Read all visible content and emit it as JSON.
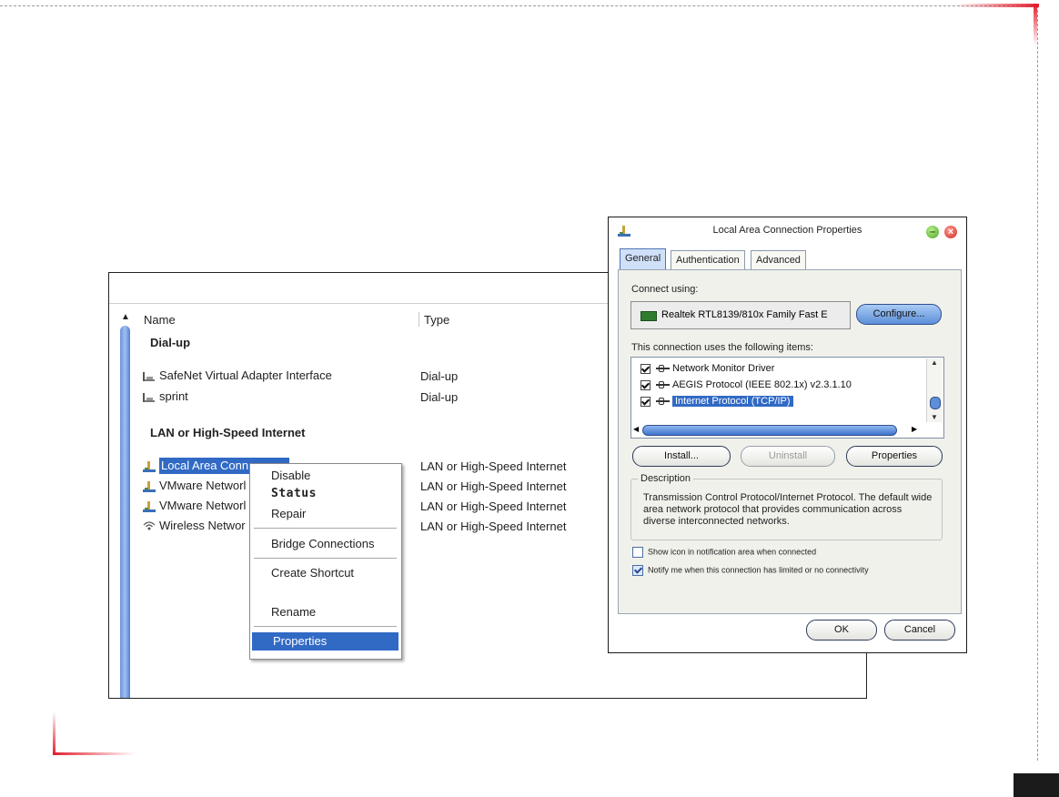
{
  "explorer": {
    "columns": {
      "name": "Name",
      "type": "Type"
    },
    "groups": {
      "dialup": "Dial-up",
      "lan": "LAN or High-Speed Internet"
    },
    "rows": [
      {
        "name": "SafeNet Virtual Adapter Interface",
        "type": "Dial-up",
        "icon": "dialup-connection-icon"
      },
      {
        "name": "sprint",
        "type": "Dial-up",
        "icon": "dialup-connection-icon"
      },
      {
        "name": "Local Area Conn",
        "type": "LAN or High-Speed Internet",
        "icon": "lan-connection-icon"
      },
      {
        "name": "VMware Networl",
        "type": "LAN or High-Speed Internet",
        "icon": "lan-connection-icon"
      },
      {
        "name": "VMware Networl",
        "type": "LAN or High-Speed Internet",
        "icon": "lan-connection-icon"
      },
      {
        "name": "Wireless Networ",
        "type": "LAN or High-Speed Internet",
        "icon": "wireless-connection-icon"
      }
    ]
  },
  "context_menu": {
    "items": [
      "Disable",
      "Status",
      "Repair",
      "Bridge Connections",
      "Create Shortcut",
      "Rename",
      "Properties"
    ],
    "highlighted": "Properties"
  },
  "dialog": {
    "title": "Local Area Connection Properties",
    "tabs": [
      "General",
      "Authentication",
      "Advanced"
    ],
    "active_tab": "General",
    "connect_using_label": "Connect using:",
    "adapter": "Realtek RTL8139/810x Family Fast E",
    "configure_button": "Configure...",
    "items_label": "This connection uses the following items:",
    "items": [
      {
        "label": "Network Monitor Driver",
        "checked": true
      },
      {
        "label": "AEGIS Protocol (IEEE 802.1x) v2.3.1.10",
        "checked": true
      },
      {
        "label": "Internet Protocol (TCP/IP)",
        "checked": true,
        "selected": true
      }
    ],
    "install_button": "Install...",
    "uninstall_button": "Uninstall",
    "properties_button": "Properties",
    "description_label": "Description",
    "description_text": "Transmission Control Protocol/Internet Protocol. The default wide area network protocol that provides communication across diverse interconnected networks.",
    "show_icon_label": "Show icon in notification area when connected",
    "show_icon_checked": false,
    "notify_label": "Notify me when this connection has limited or no connectivity",
    "notify_checked": true,
    "ok_button": "OK",
    "cancel_button": "Cancel"
  },
  "colors": {
    "selection": "#316ac5",
    "accent_red": "#e21e2d",
    "xp_blue_button": "#5c8fd8"
  }
}
